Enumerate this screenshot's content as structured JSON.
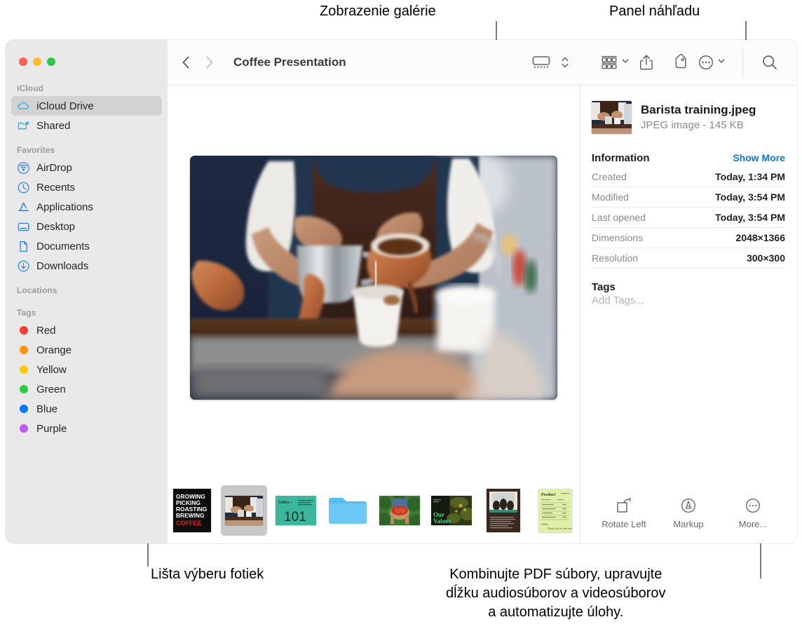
{
  "callouts": {
    "gallery_view": "Zobrazenie galérie",
    "preview_panel": "Panel náhľadu",
    "filmstrip": "Lišta výberu fotiek",
    "more_line1": "Kombinujte PDF súbory, upravujte",
    "more_line2": "dĺžku audiosúborov a videosúborov",
    "more_line3": "a automatizujte úlohy."
  },
  "window": {
    "title": "Coffee Presentation",
    "traffic_lights": [
      "close-button",
      "minimize-button",
      "zoom-button"
    ]
  },
  "toolbar": {
    "back_icon": "chevron-left-icon",
    "forward_icon": "chevron-right-icon",
    "view_icon": "gallery-view-icon",
    "view_stepper_icon": "chevron-up-down-icon",
    "group_icon": "group-by-icon",
    "group_chevron_icon": "chevron-down-icon",
    "share_icon": "share-icon",
    "tag_icon": "tag-icon",
    "more_icon": "ellipsis-circle-icon",
    "more_chevron_icon": "chevron-down-icon",
    "search_icon": "search-icon"
  },
  "sidebar": {
    "sections": [
      {
        "header": "iCloud",
        "items": [
          {
            "label": "iCloud Drive",
            "icon": "cloud-icon",
            "selected": true
          },
          {
            "label": "Shared",
            "icon": "shared-folder-icon",
            "selected": false
          }
        ]
      },
      {
        "header": "Favorites",
        "items": [
          {
            "label": "AirDrop",
            "icon": "airdrop-icon",
            "selected": false
          },
          {
            "label": "Recents",
            "icon": "clock-icon",
            "selected": false
          },
          {
            "label": "Applications",
            "icon": "applications-icon",
            "selected": false
          },
          {
            "label": "Desktop",
            "icon": "desktop-icon",
            "selected": false
          },
          {
            "label": "Documents",
            "icon": "document-icon",
            "selected": false
          },
          {
            "label": "Downloads",
            "icon": "download-icon",
            "selected": false
          }
        ]
      },
      {
        "header": "Locations",
        "items": []
      },
      {
        "header": "Tags",
        "items": [
          {
            "label": "Red",
            "icon": "tag-dot",
            "color": "#ff3b30"
          },
          {
            "label": "Orange",
            "icon": "tag-dot",
            "color": "#ff9500"
          },
          {
            "label": "Yellow",
            "icon": "tag-dot",
            "color": "#ffcc00"
          },
          {
            "label": "Green",
            "icon": "tag-dot",
            "color": "#28cd41"
          },
          {
            "label": "Blue",
            "icon": "tag-dot",
            "color": "#007aff"
          },
          {
            "label": "Purple",
            "icon": "tag-dot",
            "color": "#bf5af2"
          }
        ]
      }
    ]
  },
  "gallery": {
    "hero_alt": "barista pouring coffee from metal pitcher into paper cup",
    "filmstrip": [
      {
        "name": "growing-picking-roasting-brewing-coffee-poster",
        "selected": false
      },
      {
        "name": "barista-training-photo",
        "selected": true
      },
      {
        "name": "coffee-101-slide",
        "selected": false
      },
      {
        "name": "blue-folder",
        "selected": false
      },
      {
        "name": "coffee-cherries-basket-photo",
        "selected": false
      },
      {
        "name": "our-values-slide",
        "selected": false
      },
      {
        "name": "meeting-document",
        "selected": false
      },
      {
        "name": "invoice-spreadsheet",
        "selected": false
      }
    ]
  },
  "preview": {
    "file_name": "Barista training.jpeg",
    "file_meta": "JPEG image - 145 KB",
    "information_title": "Information",
    "show_more": "Show More",
    "rows": [
      {
        "key": "Created",
        "value": "Today, 1:34 PM"
      },
      {
        "key": "Modified",
        "value": "Today, 3:54 PM"
      },
      {
        "key": "Last opened",
        "value": "Today, 3:54 PM"
      },
      {
        "key": "Dimensions",
        "value": "2048×1366"
      },
      {
        "key": "Resolution",
        "value": "300×300"
      }
    ],
    "tags_title": "Tags",
    "add_tags_placeholder": "Add Tags...",
    "actions": [
      {
        "label": "Rotate Left",
        "icon": "rotate-left-icon"
      },
      {
        "label": "Markup",
        "icon": "markup-icon"
      },
      {
        "label": "More...",
        "icon": "ellipsis-circle-icon"
      }
    ]
  },
  "colors": {
    "accent": "#0a75e0",
    "sidebar_bg": "#e9e9e9",
    "selection": "#d2d2d2"
  }
}
